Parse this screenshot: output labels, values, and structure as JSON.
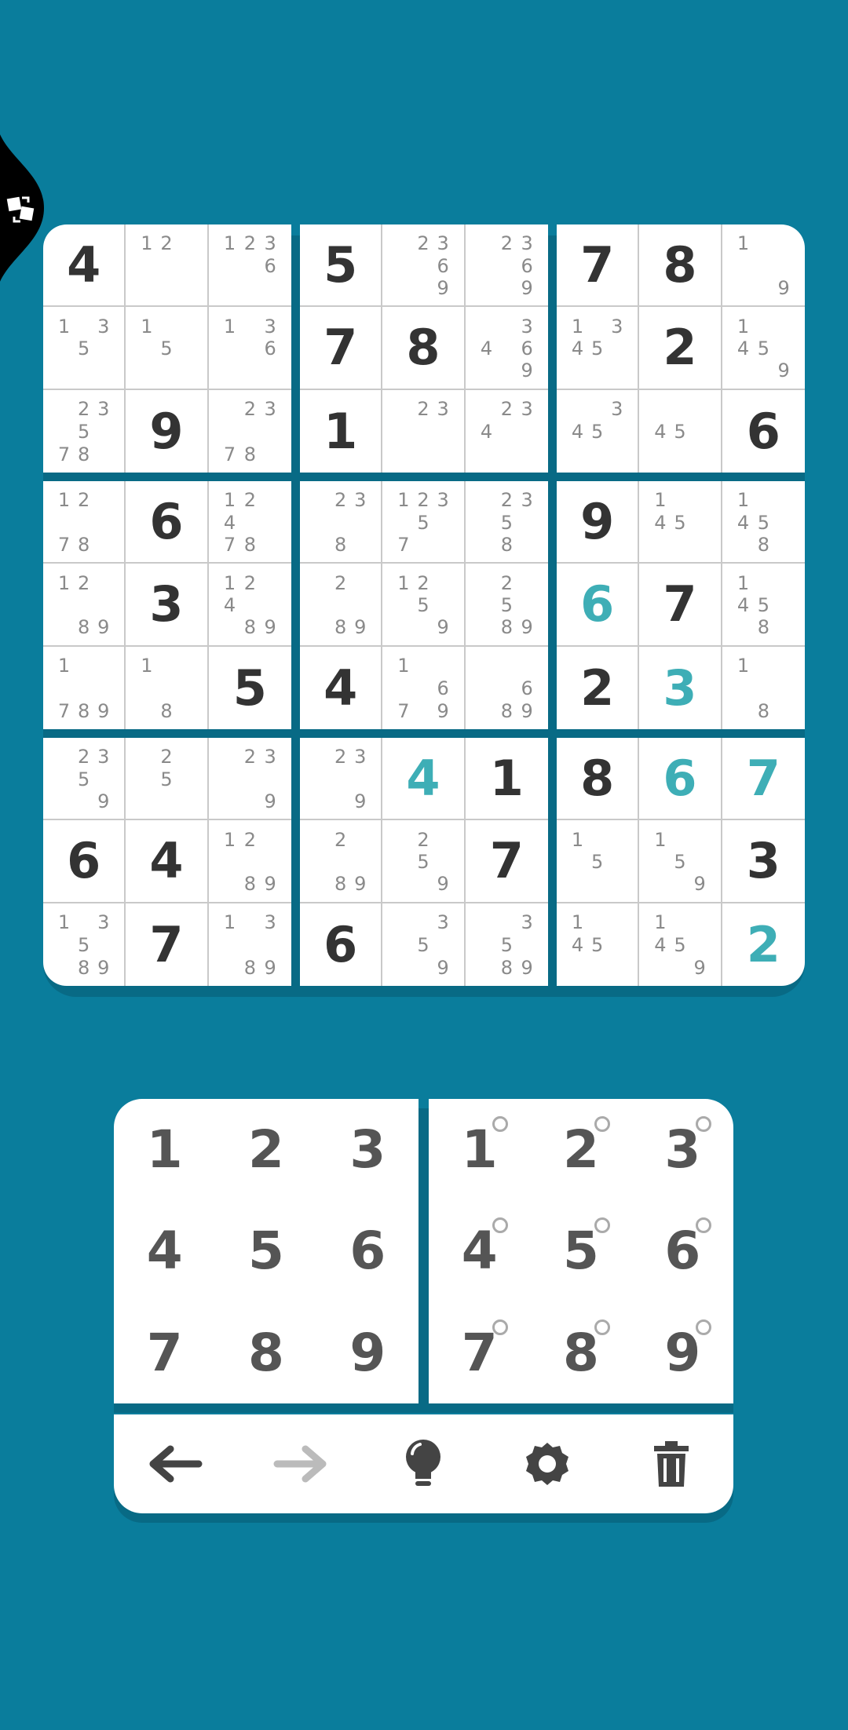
{
  "colors": {
    "background": "#0a7d9c",
    "given_digit": "#333333",
    "user_digit": "#3eaeb6",
    "note_digit": "#8a8a8a"
  },
  "side_tab": {
    "icon": "puzzle-swap-icon"
  },
  "board": [
    [
      {
        "v": "4"
      },
      {
        "n": "12"
      },
      {
        "n": "1236"
      },
      {
        "v": "5"
      },
      {
        "n": "2369"
      },
      {
        "n": "2369"
      },
      {
        "v": "7"
      },
      {
        "v": "8"
      },
      {
        "n": "19"
      }
    ],
    [
      {
        "n": "135"
      },
      {
        "n": "15"
      },
      {
        "n": "136"
      },
      {
        "v": "7"
      },
      {
        "v": "8"
      },
      {
        "n": "3469"
      },
      {
        "n": "1345"
      },
      {
        "v": "2"
      },
      {
        "n": "1459"
      }
    ],
    [
      {
        "n": "23578"
      },
      {
        "v": "9"
      },
      {
        "n": "2378"
      },
      {
        "v": "1"
      },
      {
        "n": "23"
      },
      {
        "n": "234"
      },
      {
        "n": "345"
      },
      {
        "n": "45"
      },
      {
        "v": "6"
      }
    ],
    [
      {
        "n": "1278"
      },
      {
        "v": "6"
      },
      {
        "n": "12478"
      },
      {
        "n": "238"
      },
      {
        "n": "12357"
      },
      {
        "n": "2358"
      },
      {
        "v": "9"
      },
      {
        "n": "145"
      },
      {
        "n": "1458"
      }
    ],
    [
      {
        "n": "1289"
      },
      {
        "v": "3"
      },
      {
        "n": "12489"
      },
      {
        "n": "289"
      },
      {
        "n": "1259"
      },
      {
        "n": "2589"
      },
      {
        "v": "6",
        "u": true
      },
      {
        "v": "7"
      },
      {
        "n": "1458"
      }
    ],
    [
      {
        "n": "1789"
      },
      {
        "n": "18"
      },
      {
        "v": "5"
      },
      {
        "v": "4"
      },
      {
        "n": "1679"
      },
      {
        "n": "689"
      },
      {
        "v": "2"
      },
      {
        "v": "3",
        "u": true
      },
      {
        "n": "18"
      }
    ],
    [
      {
        "n": "2359"
      },
      {
        "n": "25"
      },
      {
        "n": "239"
      },
      {
        "n": "239"
      },
      {
        "v": "4",
        "u": true
      },
      {
        "v": "1"
      },
      {
        "v": "8"
      },
      {
        "v": "6",
        "u": true
      },
      {
        "v": "7",
        "u": true
      }
    ],
    [
      {
        "v": "6"
      },
      {
        "v": "4"
      },
      {
        "n": "1289"
      },
      {
        "n": "289"
      },
      {
        "n": "259"
      },
      {
        "v": "7"
      },
      {
        "n": "15"
      },
      {
        "n": "159"
      },
      {
        "v": "3"
      }
    ],
    [
      {
        "n": "13589"
      },
      {
        "v": "7"
      },
      {
        "n": "1389"
      },
      {
        "v": "6"
      },
      {
        "n": "359"
      },
      {
        "n": "3589"
      },
      {
        "n": "145"
      },
      {
        "n": "1459"
      },
      {
        "v": "2",
        "u": true
      }
    ]
  ],
  "number_pad": {
    "digits": [
      "1",
      "2",
      "3",
      "4",
      "5",
      "6",
      "7",
      "8",
      "9"
    ],
    "note_digits": [
      "1",
      "2",
      "3",
      "4",
      "5",
      "6",
      "7",
      "8",
      "9"
    ]
  },
  "toolbar": {
    "tools": [
      {
        "name": "undo-button",
        "icon": "arrow-left-icon",
        "enabled": true
      },
      {
        "name": "redo-button",
        "icon": "arrow-right-icon",
        "enabled": false
      },
      {
        "name": "hint-button",
        "icon": "lightbulb-icon",
        "enabled": true
      },
      {
        "name": "settings-button",
        "icon": "gear-icon",
        "enabled": true
      },
      {
        "name": "erase-button",
        "icon": "trash-icon",
        "enabled": true
      }
    ]
  }
}
